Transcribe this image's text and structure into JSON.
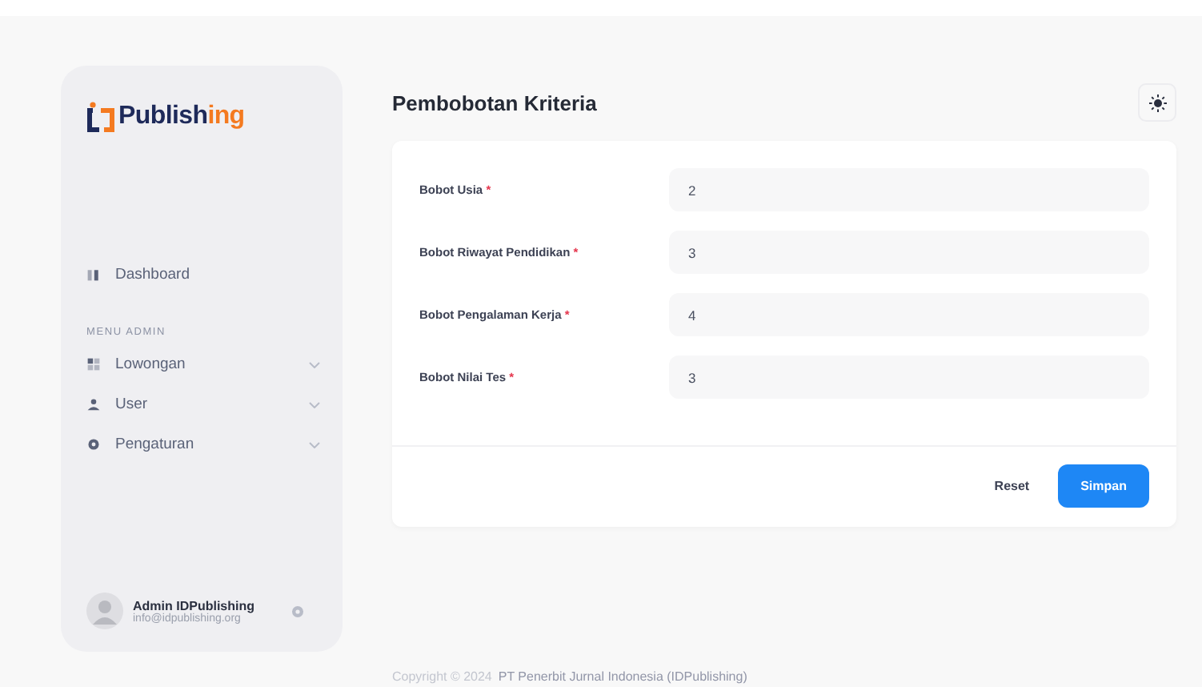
{
  "sidebar": {
    "logo": {
      "part_1": "Publish",
      "part_2": "ing"
    },
    "items": [
      {
        "label": "Dashboard",
        "has_submenu": false
      }
    ],
    "section_title": "MENU ADMIN",
    "admin_items": [
      {
        "label": "Lowongan",
        "has_submenu": true
      },
      {
        "label": "User",
        "has_submenu": true
      },
      {
        "label": "Pengaturan",
        "has_submenu": true
      }
    ],
    "user": {
      "name": "Admin IDPublishing",
      "email": "info@idpublishing.org"
    }
  },
  "page": {
    "title": "Pembobotan Kriteria",
    "fields": [
      {
        "label": "Bobot Usia",
        "required_mark": "*",
        "value": "2"
      },
      {
        "label": "Bobot Riwayat Pendidikan",
        "required_mark": "*",
        "value": "3"
      },
      {
        "label": "Bobot Pengalaman Kerja",
        "required_mark": "*",
        "value": "4"
      },
      {
        "label": "Bobot Nilai Tes",
        "required_mark": "*",
        "value": "3"
      }
    ],
    "buttons": [
      {
        "label": "Reset",
        "kind": "plain"
      },
      {
        "label": "Simpan",
        "kind": "primary"
      }
    ]
  },
  "footer": {
    "copyright": "Copyright © 2024",
    "company": "PT Penerbit Jurnal Indonesia (IDPublishing)"
  }
}
